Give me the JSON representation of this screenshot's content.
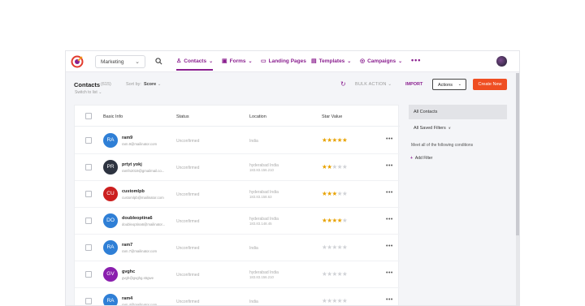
{
  "nav": {
    "workspace": "Marketing",
    "items": [
      {
        "label": "Contacts",
        "icon": "contacts-icon"
      },
      {
        "label": "Forms",
        "icon": "forms-icon"
      },
      {
        "label": "Landing Pages",
        "icon": "landing-pages-icon"
      },
      {
        "label": "Templates",
        "icon": "templates-icon"
      },
      {
        "label": "Campaigns",
        "icon": "campaigns-icon"
      }
    ],
    "more": "•••"
  },
  "header": {
    "title": "Contacts",
    "count": "(615)",
    "sort_label": "Sort by:",
    "sort_value": "Score",
    "switch_list": "Switch to list",
    "bulk_action": "BULK ACTION",
    "import": "IMPORT",
    "actions": "Actions",
    "create": "Create New"
  },
  "table": {
    "columns": [
      "Basic Info",
      "Status",
      "Location",
      "Star Value"
    ],
    "rows": [
      {
        "initials": "RA",
        "name": "ram9",
        "email": "ram.9@mailinator.com",
        "status": "Unconfirmed",
        "location": "India",
        "ip": "",
        "stars": 5,
        "color": "#2f7fd6"
      },
      {
        "initials": "PR",
        "name": "prtyt yokj",
        "email": "ramfn2019@gmailmail.co...",
        "status": "Unconfirmed",
        "location": "hyderabad India",
        "ip": "183.83.156.210",
        "stars": 2,
        "color": "#2d3340"
      },
      {
        "initials": "CU",
        "name": "customlpb",
        "email": "customlpb@mailinator.com",
        "status": "Unconfirmed",
        "location": "hyderabad India",
        "ip": "183.83.158.63",
        "stars": 3,
        "color": "#cc1f1f"
      },
      {
        "initials": "DO",
        "name": "doubleoptina6",
        "email": "doubleoptina6@mailinator...",
        "status": "Unconfirmed",
        "location": "hyderabad India",
        "ip": "183.83.148.45",
        "stars": 4,
        "color": "#2f7fd6"
      },
      {
        "initials": "RA",
        "name": "ram7",
        "email": "ram.7@mailinator.com",
        "status": "Unconfirmed",
        "location": "India",
        "ip": "",
        "stars": 0,
        "color": "#2f7fd6"
      },
      {
        "initials": "GV",
        "name": "gvghc",
        "email": "gvgh@gvghg.s5gwe",
        "status": "Unconfirmed",
        "location": "hyderabad India",
        "ip": "183.83.156.210",
        "stars": 0,
        "color": "#8a1fae"
      },
      {
        "initials": "RA",
        "name": "ram4",
        "email": "ram.4@mailinator.com",
        "status": "Unconfirmed",
        "location": "India",
        "ip": "",
        "stars": 0,
        "color": "#2f7fd6"
      }
    ]
  },
  "sidebar": {
    "all_contacts": "All Contacts",
    "all_saved_filters": "All Saved Filters",
    "meet": "Meet all of the following conditions",
    "add_filter": "Add Filter"
  },
  "colors": {
    "brand": "#8a1f8f",
    "accent": "#ef4e22",
    "star": "#e8a200"
  }
}
